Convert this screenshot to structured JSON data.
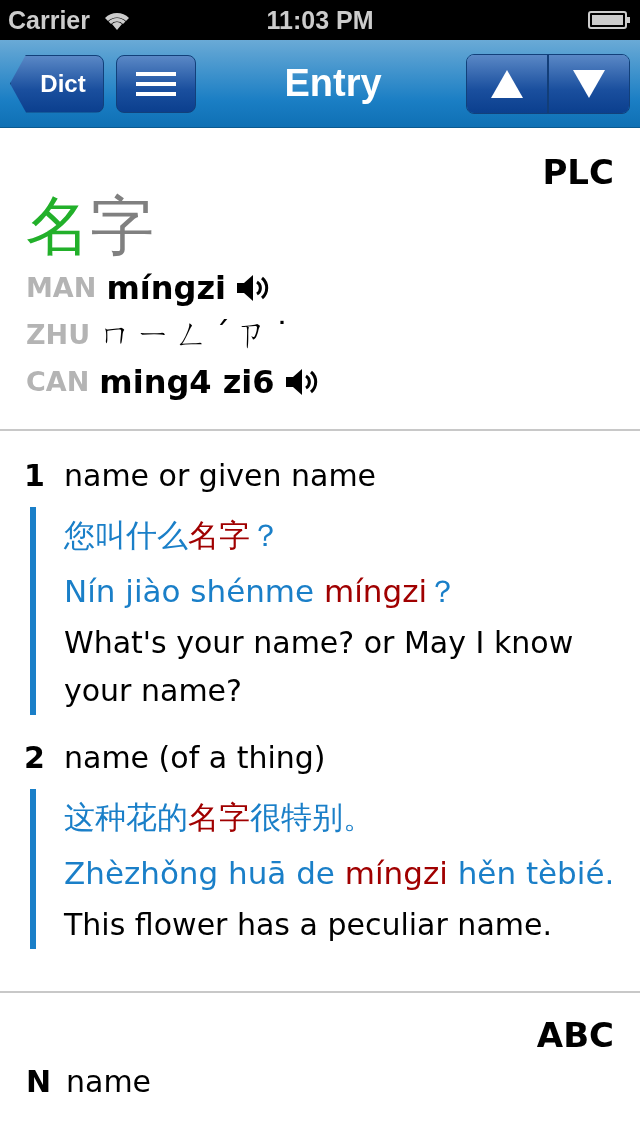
{
  "status_bar": {
    "carrier": "Carrier",
    "time": "11:03 PM"
  },
  "nav_bar": {
    "back_button": "Dict",
    "title": "Entry"
  },
  "entry": {
    "source": "PLC",
    "headword": [
      {
        "char": "名",
        "color": "#22b02a"
      },
      {
        "char": "字",
        "color": "#808080"
      }
    ],
    "readings": [
      {
        "label": "MAN",
        "text": "míngzi",
        "audio": true
      },
      {
        "label": "ZHU",
        "text": "ㄇㄧㄥˊㄗ˙",
        "audio": false
      },
      {
        "label": "CAN",
        "text": "ming4 zi6",
        "audio": true
      }
    ],
    "senses": [
      {
        "number": "1",
        "definition": "name or given name",
        "examples": [
          {
            "hanzi": [
              {
                "text": "您叫什么",
                "highlight": false
              },
              {
                "text": "名字",
                "highlight": true
              },
              {
                "text": "？",
                "highlight": false
              }
            ],
            "pinyin": [
              {
                "text": "Nín jiào shénme ",
                "highlight": false
              },
              {
                "text": "míngzi",
                "highlight": true
              },
              {
                "text": "？",
                "highlight": false
              }
            ],
            "translation": "What's your name? or May I know your name?"
          }
        ]
      },
      {
        "number": "2",
        "definition": "name (of a thing)",
        "examples": [
          {
            "hanzi": [
              {
                "text": "这种花的",
                "highlight": false
              },
              {
                "text": "名字",
                "highlight": true
              },
              {
                "text": "很特别。",
                "highlight": false
              }
            ],
            "pinyin": [
              {
                "text": "Zhèzhǒng huā de ",
                "highlight": false
              },
              {
                "text": "míngzi",
                "highlight": true
              },
              {
                "text": " hěn tèbié.",
                "highlight": false
              }
            ],
            "translation": "This flower has a peculiar name."
          }
        ]
      }
    ]
  },
  "next_entry": {
    "source": "ABC",
    "number": "N",
    "definition": "name"
  }
}
